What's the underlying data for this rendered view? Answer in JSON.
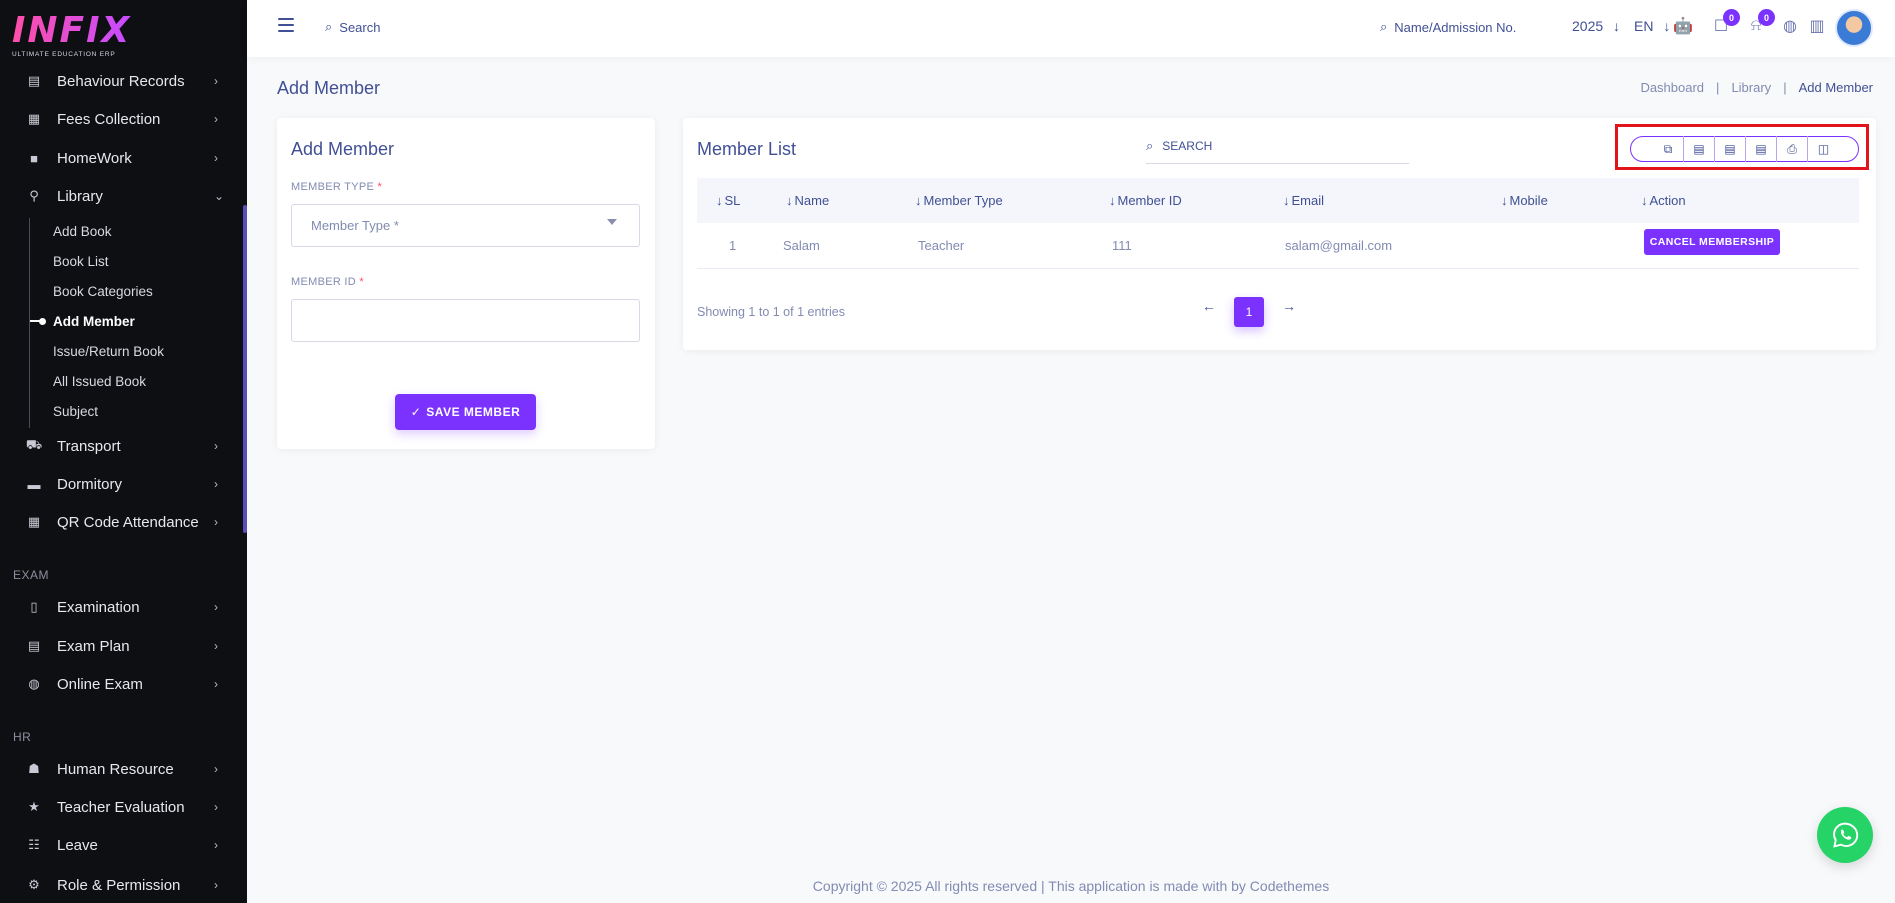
{
  "brand": {
    "logo": "INFIX",
    "tagline": "ULTIMATE EDUCATION ERP"
  },
  "sidebar": {
    "items_top": [
      {
        "label": "Behaviour Records",
        "icon": "behaviour-icon"
      },
      {
        "label": "Fees Collection",
        "icon": "fees-icon"
      },
      {
        "label": "HomeWork",
        "icon": "homework-icon"
      },
      {
        "label": "Library",
        "icon": "library-icon"
      }
    ],
    "library_sub": [
      "Add Book",
      "Book List",
      "Book Categories",
      "Add Member",
      "Issue/Return Book",
      "All Issued Book",
      "Subject"
    ],
    "items_mid": [
      {
        "label": "Transport",
        "icon": "transport-icon"
      },
      {
        "label": "Dormitory",
        "icon": "dormitory-icon"
      },
      {
        "label": "QR Code Attendance",
        "icon": "qr-icon"
      }
    ],
    "section_exam": "EXAM",
    "items_exam": [
      {
        "label": "Examination",
        "icon": "examination-icon"
      },
      {
        "label": "Exam Plan",
        "icon": "exam-plan-icon"
      },
      {
        "label": "Online Exam",
        "icon": "globe-icon"
      }
    ],
    "section_hr": "HR",
    "items_hr": [
      {
        "label": "Human Resource",
        "icon": "people-icon"
      },
      {
        "label": "Teacher Evaluation",
        "icon": "star-icon"
      },
      {
        "label": "Leave",
        "icon": "leave-icon"
      },
      {
        "label": "Role & Permission",
        "icon": "role-icon"
      }
    ]
  },
  "header": {
    "search_label": "Search",
    "name_search_label": "Name/Admission No.",
    "year": "2025",
    "lang": "EN",
    "chat_badge": "0",
    "notif_badge": "0"
  },
  "page": {
    "title": "Add Member",
    "breadcrumb": [
      "Dashboard",
      "Library",
      "Add Member"
    ]
  },
  "form": {
    "title": "Add Member",
    "member_type_label": "MEMBER TYPE",
    "member_type_placeholder": "Member Type *",
    "member_id_label": "MEMBER ID",
    "member_id_value": "",
    "required_mark": "*",
    "save_label": "SAVE MEMBER"
  },
  "list": {
    "title": "Member List",
    "search_label": "SEARCH",
    "columns": [
      "SL",
      "Name",
      "Member Type",
      "Member ID",
      "Email",
      "Mobile",
      "Action"
    ],
    "rows": [
      {
        "sl": "1",
        "name": "Salam",
        "member_type": "Teacher",
        "member_id": "111",
        "email": "salam@gmail.com",
        "mobile": "",
        "action": "CANCEL MEMBERSHIP"
      }
    ],
    "showing": "Showing 1 to 1 of 1 entries",
    "current_page": "1",
    "export_buttons": [
      "copy-icon",
      "excel-icon",
      "csv-icon",
      "pdf-icon",
      "print-icon",
      "columns-icon"
    ]
  },
  "footer": {
    "text": "Copyright © 2025 All rights reserved | This application is made with by Codethemes"
  },
  "colors": {
    "accent": "#7c32ff",
    "sidebar_bg": "#0e0f12",
    "text_primary": "#415094",
    "text_muted": "#828bb2",
    "highlight": "#e2141b",
    "whatsapp": "#25d366"
  }
}
